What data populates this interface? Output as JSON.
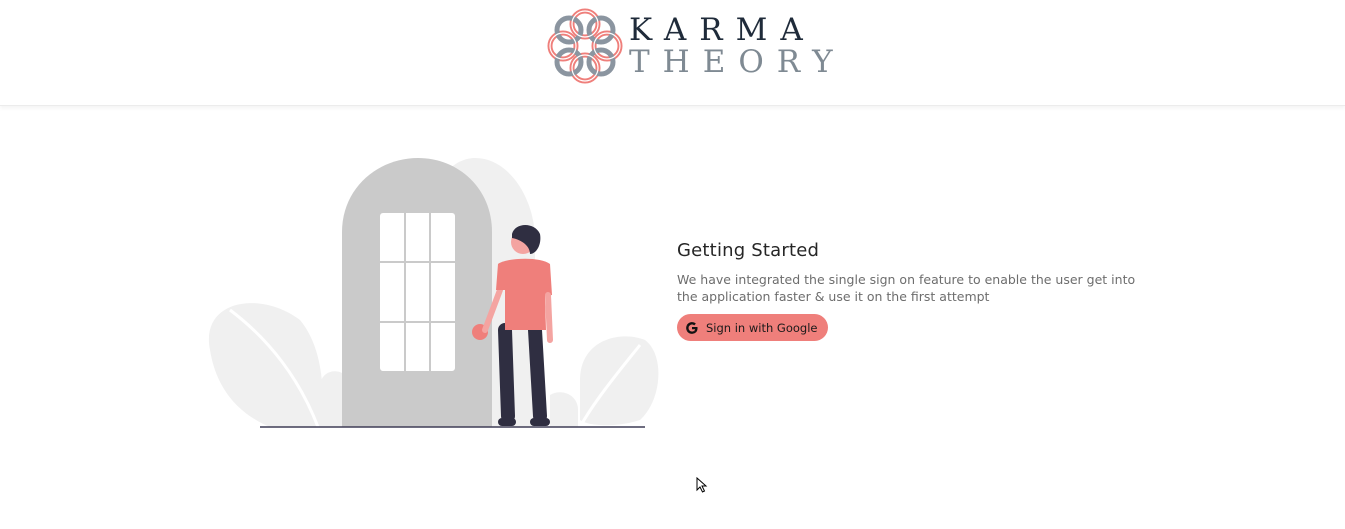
{
  "header": {
    "logo": {
      "word_top": "KARMA",
      "word_bottom": "THEORY",
      "icon": "karma-theory-knot-logo"
    }
  },
  "main": {
    "illustration": "person-at-door-illustration",
    "title": "Getting Started",
    "description": "We have integrated the single sign on feature to enable the user get into the application faster & use it on the first attempt",
    "sign_in_button": {
      "label": "Sign in with Google",
      "icon": "google-icon"
    }
  },
  "colors": {
    "accent": "#ef7f7b",
    "logo_dark": "#1f2b3a",
    "logo_gray": "#7f8a93"
  }
}
